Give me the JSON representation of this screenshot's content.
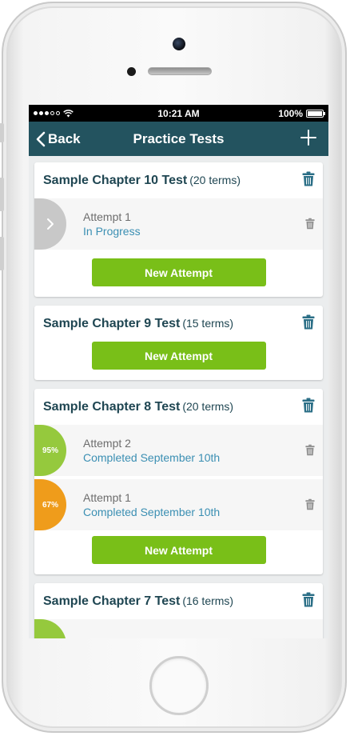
{
  "status_bar": {
    "time": "10:21 AM",
    "battery": "100%",
    "battery_level": 1.0
  },
  "nav": {
    "back_label": "Back",
    "title": "Practice Tests"
  },
  "colors": {
    "nav_background": "#23535f",
    "title_text": "#1f4652",
    "link_text": "#3b8fb3",
    "button_green": "#79bf18",
    "badge_gray": "#c8c8c8",
    "badge_green": "#95c93d",
    "badge_orange": "#ef9c1b"
  },
  "tests": [
    {
      "title": "Sample Chapter 10 Test",
      "terms": "(20 terms)",
      "attempts": [
        {
          "label": "Attempt 1",
          "status": "In Progress",
          "badge": "",
          "badge_icon": "chevron-right-icon"
        }
      ],
      "new_attempt_label": "New Attempt"
    },
    {
      "title": "Sample Chapter 9 Test",
      "terms": "(15 terms)",
      "attempts": [],
      "new_attempt_label": "New Attempt"
    },
    {
      "title": "Sample Chapter 8 Test",
      "terms": "(20 terms)",
      "attempts": [
        {
          "label": "Attempt 2",
          "status": "Completed September 10th",
          "badge": "95%",
          "score": 95
        },
        {
          "label": "Attempt 1",
          "status": "Completed September 10th",
          "badge": "67%",
          "score": 67
        }
      ],
      "new_attempt_label": "New Attempt"
    },
    {
      "title": "Sample Chapter 7 Test",
      "terms": "(16 terms)",
      "attempts": []
    }
  ],
  "icons": {
    "back": "chevron-left-icon",
    "add": "plus-icon",
    "delete": "trash-icon"
  }
}
